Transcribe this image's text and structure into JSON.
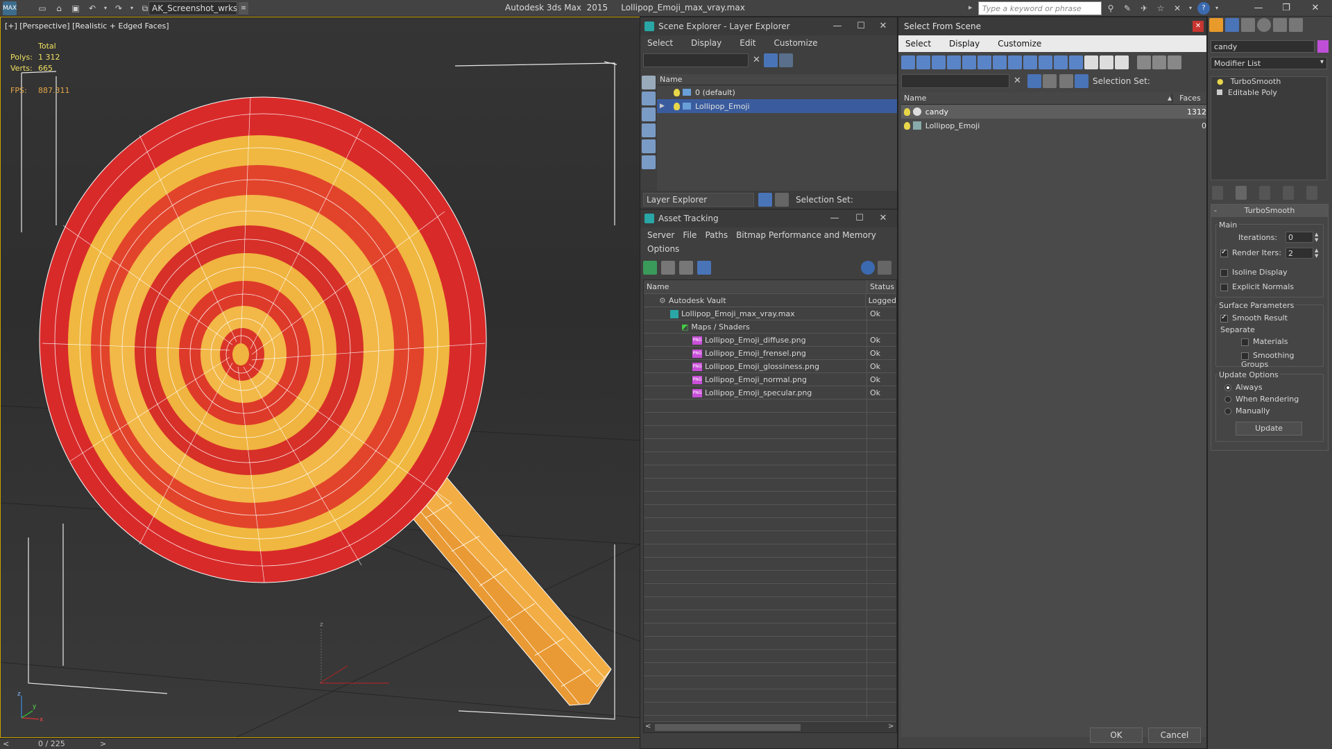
{
  "titlebar": {
    "app_icon": "MAX",
    "workspace": "AK_Screenshot_wrksp",
    "title": "Autodesk 3ds Max  2015     Lollipop_Emoji_max_vray.max",
    "search_placeholder": "Type a keyword or phrase"
  },
  "viewport": {
    "label": "[+] [Perspective] [Realistic + Edged Faces]",
    "stats": {
      "total": "Total",
      "polys_label": "Polys:",
      "polys": "1 312",
      "verts_label": "Verts:",
      "verts": "665",
      "fps_label": "FPS:",
      "fps": "887.311"
    },
    "axis": {
      "x": "x",
      "y": "y",
      "z": "z"
    }
  },
  "timeslider": {
    "frame": "0 / 225"
  },
  "scene_explorer": {
    "title": "Scene Explorer - Layer Explorer",
    "menu": [
      "Select",
      "Display",
      "Edit",
      "Customize"
    ],
    "column_name": "Name",
    "layers": [
      {
        "name": "0 (default)",
        "selected": false
      },
      {
        "name": "Lollipop_Emoji",
        "selected": true
      }
    ],
    "footer_dropdown": "Layer Explorer",
    "selection_set_label": "Selection Set:"
  },
  "asset_tracking": {
    "title": "Asset Tracking",
    "menu1": [
      "Server",
      "File",
      "Paths",
      "Bitmap Performance and Memory"
    ],
    "menu2": [
      "Options"
    ],
    "columns": {
      "name": "Name",
      "status": "Status"
    },
    "rows": [
      {
        "name": "Autodesk Vault",
        "status": "Logged",
        "indent": 1,
        "icon": "vault-icon"
      },
      {
        "name": "Lollipop_Emoji_max_vray.max",
        "status": "Ok",
        "indent": 2,
        "icon": "max-file-icon"
      },
      {
        "name": "Maps / Shaders",
        "status": "",
        "indent": 3,
        "icon": "maps-icon"
      },
      {
        "name": "Lollipop_Emoji_diffuse.png",
        "status": "Ok",
        "indent": 4,
        "icon": "png-icon"
      },
      {
        "name": "Lollipop_Emoji_frensel.png",
        "status": "Ok",
        "indent": 4,
        "icon": "png-icon"
      },
      {
        "name": "Lollipop_Emoji_glossiness.png",
        "status": "Ok",
        "indent": 4,
        "icon": "png-icon"
      },
      {
        "name": "Lollipop_Emoji_normal.png",
        "status": "Ok",
        "indent": 4,
        "icon": "png-icon"
      },
      {
        "name": "Lollipop_Emoji_specular.png",
        "status": "Ok",
        "indent": 4,
        "icon": "png-icon"
      }
    ],
    "png_badge": "PNG"
  },
  "select_from_scene": {
    "title": "Select From Scene",
    "menu": [
      "Select",
      "Display",
      "Customize"
    ],
    "selection_set_label": "Selection Set:",
    "columns": {
      "name": "Name",
      "faces": "Faces"
    },
    "rows": [
      {
        "name": "candy",
        "faces": "1312",
        "selected": true
      },
      {
        "name": "Lollipop_Emoji",
        "faces": "0",
        "selected": false
      }
    ],
    "ok": "OK",
    "cancel": "Cancel"
  },
  "command_panel": {
    "object_name": "candy",
    "modifier_list": "Modifier List",
    "stack": [
      "TurboSmooth",
      "Editable Poly"
    ],
    "rollout_title": "TurboSmooth",
    "main_label": "Main",
    "iterations_label": "Iterations:",
    "iterations": "0",
    "render_iters_label": "Render Iters:",
    "render_iters": "2",
    "isoline": "Isoline Display",
    "explicit_normals": "Explicit Normals",
    "surface_params": "Surface Parameters",
    "smooth_result": "Smooth Result",
    "separate": "Separate",
    "materials": "Materials",
    "smoothing_groups": "Smoothing Groups",
    "update_options": "Update Options",
    "always": "Always",
    "when_rendering": "When Rendering",
    "manually": "Manually",
    "update_button": "Update"
  },
  "colors": {
    "viewport_border": "#c9a100",
    "selection_blue": "#3a5c9e",
    "candy_red": "#d92a2a",
    "candy_yellow": "#f0b840",
    "stick_orange": "#efa23c"
  }
}
